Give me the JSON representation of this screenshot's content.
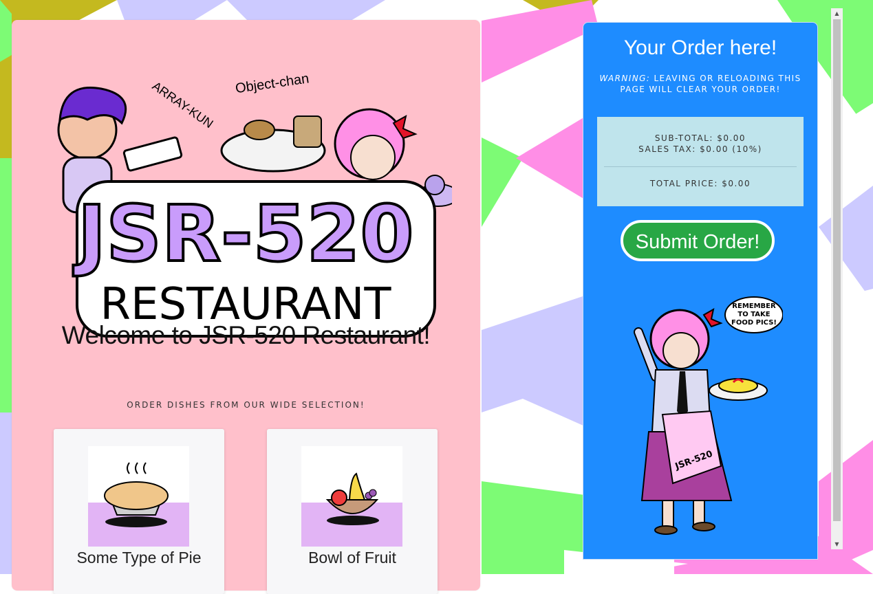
{
  "menu": {
    "welcome": "Welcome to JSR-520 Restaurant!",
    "subtitle": "ORDER DISHES FROM OUR WIDE SELECTION!",
    "dishes": [
      {
        "name": "Some Type of Pie"
      },
      {
        "name": "Bowl of Fruit"
      }
    ]
  },
  "logo": {
    "title": "JSR-520",
    "subtitle": "RESTAURANT",
    "label_left": "ARRAY-KUN",
    "label_right": "Object-chan"
  },
  "order": {
    "title": "Your Order here!",
    "warning_label": "WARNING:",
    "warning_text": "LEAVING OR RELOADING THIS PAGE WILL CLEAR YOUR ORDER!",
    "subtotal": "SUB-TOTAL: $0.00",
    "sales_tax": "SALES TAX: $0.00 (10%)",
    "total": "TOTAL PRICE: $0.00",
    "submit_label": "Submit Order!",
    "mascot_speech": [
      "REMEMBER",
      "TO TAKE",
      "FOOD PICS!"
    ],
    "apron_text": "JSR-520"
  },
  "colors": {
    "menu_bg": "#ffc0cb",
    "order_bg": "#1e8cff",
    "summary_bg": "#bfe4ec",
    "submit_bg": "#28a745",
    "bg_purple": "#cccaff",
    "bg_green": "#7dfb75",
    "bg_pink": "#ff8ee6",
    "bg_olive": "#c4b91f"
  },
  "scrollbar": {
    "up_icon": "▲",
    "down_icon": "▼"
  }
}
